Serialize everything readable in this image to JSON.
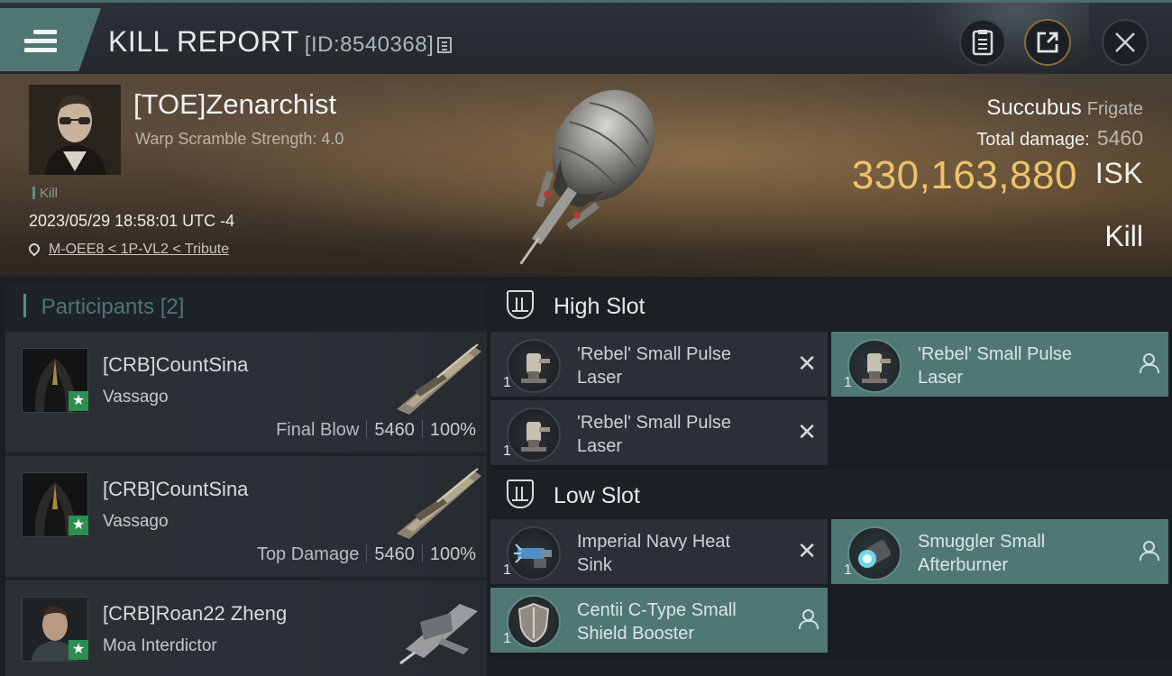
{
  "header": {
    "title": "KILL REPORT",
    "report_id": "[ID:8540368]"
  },
  "victim": {
    "name": "[TOE]Zenarchist",
    "warp_scramble": "Warp Scramble Strength: 4.0",
    "tag": "Kill",
    "datetime": "2023/05/29 18:58:01 UTC -4",
    "location": "M-OEE8 < 1P-VL2 < Tribute",
    "ship_name": "Succubus",
    "ship_class": "Frigate",
    "total_damage_label": "Total damage:",
    "total_damage": "5460",
    "isk_value": "330,163,880",
    "isk_unit": "ISK",
    "result": "Kill"
  },
  "participants": {
    "title": "Participants",
    "count": "[2]",
    "rows": [
      {
        "name": "[CRB]CountSina",
        "ship": "Vassago",
        "label": "Final Blow",
        "damage": "5460",
        "percent": "100%"
      },
      {
        "name": "[CRB]CountSina",
        "ship": "Vassago",
        "label": "Top Damage",
        "damage": "5460",
        "percent": "100%"
      },
      {
        "name": "[CRB]Roan22 Zheng",
        "ship": "Moa Interdictor"
      }
    ]
  },
  "slots": {
    "high": {
      "title": "High Slot",
      "modules": [
        {
          "line1": "'Rebel' Small Pulse",
          "line2": "Laser",
          "qty": "1",
          "state": "destroyed"
        },
        {
          "line1": "'Rebel' Small Pulse",
          "line2": "Laser",
          "qty": "1",
          "state": "dropped"
        },
        {
          "line1": "'Rebel' Small Pulse",
          "line2": "Laser",
          "qty": "1",
          "state": "destroyed"
        }
      ]
    },
    "low": {
      "title": "Low Slot",
      "modules": [
        {
          "line1": "Imperial Navy Heat",
          "line2": "Sink",
          "qty": "1",
          "state": "destroyed"
        },
        {
          "line1": "Smuggler Small",
          "line2": "Afterburner",
          "qty": "1",
          "state": "dropped"
        },
        {
          "line1": "Centii C-Type Small",
          "line2": "Shield Booster",
          "qty": "1",
          "state": "dropped"
        }
      ]
    }
  },
  "colors": {
    "accent_teal": "#4f7874",
    "isk_gold": "#eec26a",
    "badge_green": "#2c8f51"
  }
}
